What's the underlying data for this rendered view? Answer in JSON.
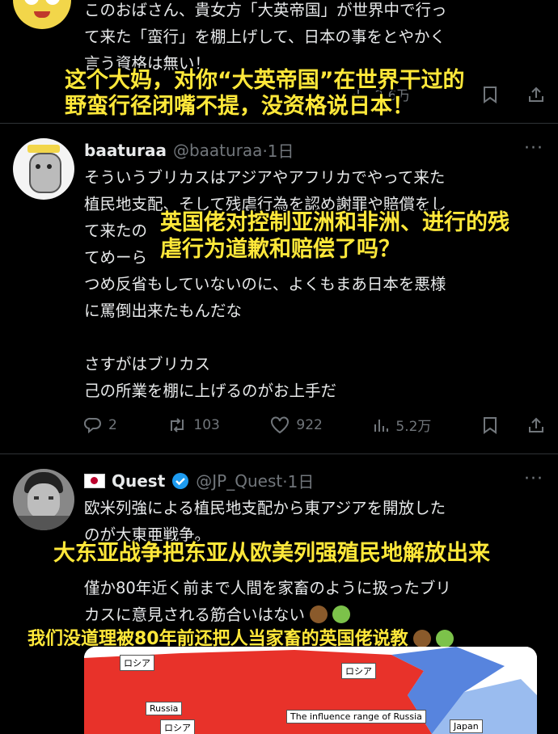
{
  "post1": {
    "lines": [
      "このおばさん、貴女方「大英帝国」が世界中で行っ",
      "て来た「蛮行」を棚上げして、日本の事をとやかく",
      "言う資格は無い！"
    ],
    "caption": [
      "这个大妈，对你“大英帝国”在世界干过的",
      "野蛮行径闭嘴不提，没资格说日本！"
    ],
    "views": "2.6万"
  },
  "post2": {
    "name": "baaturaa",
    "handle": "@baaturaa",
    "time": "·1日",
    "lines": [
      "そういうブリカスはアジアやアフリカでやって来た",
      "植民地支配、そして残虐行為を認め謝罪や賠償をし",
      "て来たの",
      "てめーら",
      "つめ反省もしていないのに、よくもまあ日本を悪様",
      "に罵倒出来たもんだな",
      "",
      "さすがはブリカス",
      "己の所業を棚に上げるのがお上手だ"
    ],
    "caption": [
      "英国佬对控制亚洲和非洲、进行的残",
      "虐行为道歉和赔偿了吗？"
    ],
    "replies": "2",
    "reposts": "103",
    "likes": "922",
    "views": "5.2万"
  },
  "post3": {
    "name": "Quest",
    "handle": "@JP_Quest",
    "time": "·1日",
    "lines": [
      "欧米列強による植民地支配から東アジアを開放した",
      "のが大東亜戦争。",
      "",
      "僅か80年近く前まで人間を家畜のように扱ったブリ",
      "カスに意見される筋合いはない"
    ],
    "caption1": "大东亚战争把东亚从欧美列强殖民地解放出来",
    "caption2": "我们没道理被80年前还把人当家畜的英国佬说教"
  },
  "map": {
    "labels": [
      "ロシア",
      "ロシア",
      "Russia",
      "ロシア",
      "The influence range of Russia",
      "Japan"
    ]
  },
  "colors": {
    "accent": "#ffe83a",
    "muted": "#71767b",
    "verified": "#1d9bf0",
    "map_red": "#e8322a"
  },
  "icons": [
    "reply-icon",
    "repost-icon",
    "like-icon",
    "views-icon",
    "bookmark-icon",
    "share-icon",
    "verified-badge-icon",
    "japan-flag-icon",
    "more-icon"
  ]
}
